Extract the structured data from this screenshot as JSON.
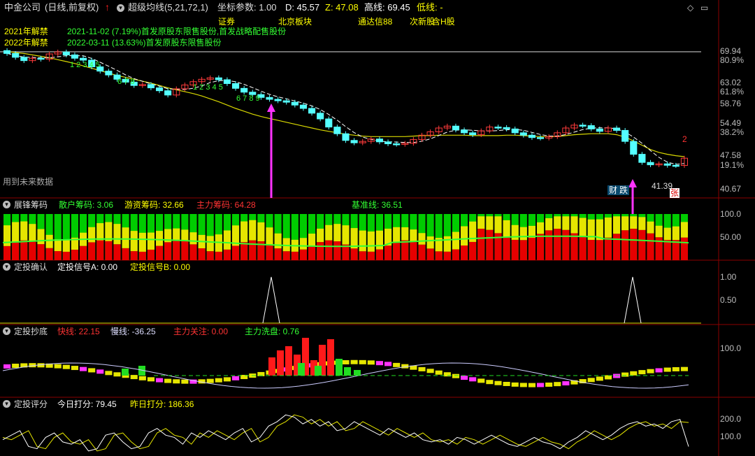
{
  "header": {
    "title": "中金公司",
    "mode": "(日线,前复权)",
    "indicator": "超级均线(5,21,72,1)",
    "coord_label": "坐标参数: 1.00",
    "d_label": "D: 45.57",
    "z_label": "Z: 47.08",
    "high_label": "高线: 69.45",
    "low_label": "低线: -",
    "colors": {
      "title": "#dddddd",
      "d": "#ffffff",
      "z": "#ffff00",
      "high": "#ffffff",
      "low": "#ffff00"
    }
  },
  "main": {
    "notes": [
      {
        "tag": "2021年解禁",
        "text": "2021-11-02 (7.19%)首发原股东限售股份,首发战略配售股份"
      },
      {
        "tag": "2022年解禁",
        "text": "2022-03-11 (13.63%)首发原股东限售股份"
      }
    ],
    "sector_tags": [
      "证券",
      "北京板块",
      "通达信88",
      "次新股",
      "含H股"
    ],
    "future_label": "用到未来数据",
    "price_axis": [
      "69.94",
      "80.9%",
      "63.02",
      "61.8%",
      "58.76",
      "54.49",
      "38.2%",
      "47.58",
      "19.1%",
      "40.67"
    ],
    "markers": {
      "cai": "财",
      "die": "跌",
      "zhang": "张",
      "low_val": "41.39",
      "top_digit": "2"
    },
    "seq_labels": [
      "1 2 3 4 5",
      "6 7 8",
      "1 2 3 4 5",
      "6 7 8 9"
    ]
  },
  "chip": {
    "title": "展锋筹码",
    "items": [
      {
        "label": "散户筹码: 3.06",
        "color": "#ffff00"
      },
      {
        "label": "游资筹码: 32.66",
        "color": "#ffff00"
      },
      {
        "label": "主力筹码: 64.28",
        "color": "#ff3333"
      },
      {
        "label": "基准线: 36.51",
        "color": "#33ff33"
      }
    ],
    "axis": [
      "100.0",
      "50.00"
    ]
  },
  "confirm": {
    "title": "定投确认",
    "items": [
      {
        "label": "定投信号A: 0.00",
        "color": "#ffffff"
      },
      {
        "label": "定投信号B: 0.00",
        "color": "#ffff00"
      }
    ],
    "axis": [
      "1.00",
      "0.50"
    ]
  },
  "bottom": {
    "title": "定投抄底",
    "items": [
      {
        "label": "快线: 22.15",
        "color": "#ff3333"
      },
      {
        "label": "慢线: -36.25",
        "color": "#ddddff"
      },
      {
        "label": "主力关注: 0.00",
        "color": "#ff3333"
      },
      {
        "label": "主力洗盘: 0.76",
        "color": "#33ff33"
      }
    ],
    "axis": [
      "100.0"
    ]
  },
  "score": {
    "title": "定投评分",
    "items": [
      {
        "label": "今日打分: 79.45",
        "color": "#ffffff"
      },
      {
        "label": "昨日打分: 186.36",
        "color": "#ffff00"
      }
    ],
    "axis": [
      "200.0",
      "100.0"
    ]
  },
  "chart_data": [
    {
      "type": "candlestick",
      "title": "中金公司 (日线,前复权)",
      "ylim": [
        40.67,
        69.94
      ],
      "candles_close": [
        69.0,
        68.2,
        67.5,
        68.0,
        67.8,
        68.9,
        69.3,
        68.7,
        68.0,
        67.6,
        66.2,
        65.3,
        64.5,
        63.6,
        63.0,
        62.3,
        62.5,
        61.8,
        61.2,
        60.3,
        61.6,
        62.4,
        63.1,
        63.6,
        63.9,
        63.5,
        62.7,
        61.7,
        60.9,
        60.4,
        59.8,
        59.4,
        59.1,
        58.8,
        58.2,
        57.5,
        56.5,
        55.3,
        53.6,
        52.2,
        50.8,
        50.3,
        50.6,
        51.1,
        50.5,
        50.1,
        50.0,
        50.2,
        51.0,
        51.9,
        52.6,
        53.4,
        53.8,
        53.0,
        52.4,
        52.0,
        52.8,
        53.6,
        53.5,
        53.2,
        52.4,
        51.9,
        51.4,
        51.3,
        51.6,
        52.4,
        53.4,
        54.0,
        53.9,
        53.2,
        52.7,
        53.4,
        52.9,
        50.6,
        47.9,
        46.2,
        45.7,
        45.9,
        45.6,
        45.57,
        47.08
      ],
      "ma_yellow": [
        69.4,
        69.2,
        69.0,
        68.7,
        68.4,
        68.1,
        67.7,
        67.3,
        66.9,
        66.4,
        65.9,
        65.4,
        64.9,
        64.4,
        64.0,
        63.6,
        63.2,
        62.8,
        62.3,
        61.8,
        61.4,
        61.0,
        60.6,
        60.1,
        59.5,
        58.9,
        58.2,
        57.5,
        56.9,
        56.3,
        55.8,
        55.4,
        55.0,
        54.6,
        54.2,
        53.8,
        53.4,
        53.0,
        52.7,
        52.4,
        52.1,
        51.9,
        51.7,
        51.6,
        51.6,
        51.6,
        51.6,
        51.6,
        51.7,
        51.8,
        51.8,
        51.9,
        51.9,
        51.9,
        51.9,
        51.8,
        51.8,
        51.8,
        51.8,
        51.9,
        51.9,
        51.8,
        51.7,
        51.6,
        51.6,
        51.6,
        51.8,
        52.0,
        52.1,
        52.2,
        52.2,
        52.2,
        52.0,
        51.5,
        50.7,
        49.8,
        48.9,
        48.3,
        47.9,
        47.6,
        47.4
      ]
    },
    {
      "type": "bar",
      "title": "展锋筹码",
      "ylim": [
        0,
        100
      ],
      "series": [
        {
          "name": "散户筹码",
          "value": 3.06
        },
        {
          "name": "游资筹码",
          "value": 32.66
        },
        {
          "name": "主力筹码",
          "value": 64.28
        },
        {
          "name": "基准线",
          "value": 36.51
        }
      ]
    },
    {
      "type": "line",
      "title": "定投确认",
      "ylim": [
        0,
        1
      ],
      "series": [
        {
          "name": "定投信号A",
          "values": [
            0.0
          ]
        },
        {
          "name": "定投信号B",
          "values": [
            0.0
          ]
        }
      ],
      "spikes_at_index": [
        38,
        90
      ]
    },
    {
      "type": "bar",
      "title": "定投抄底",
      "series": [
        {
          "name": "快线",
          "value": 22.15
        },
        {
          "name": "慢线",
          "value": -36.25
        },
        {
          "name": "主力关注",
          "value": 0.0
        },
        {
          "name": "主力洗盘",
          "value": 0.76
        }
      ]
    },
    {
      "type": "line",
      "title": "定投评分",
      "ylim": [
        50,
        230
      ],
      "series": [
        {
          "name": "今日打分",
          "values": [
            110,
            130,
            150,
            80,
            70,
            120,
            140,
            100,
            90,
            110,
            60,
            70,
            130,
            140,
            100,
            70,
            80,
            140,
            160,
            130,
            120,
            90,
            140,
            120,
            150,
            130,
            110,
            140,
            160,
            100,
            120,
            170,
            190,
            220,
            210,
            180,
            200,
            170,
            190,
            150,
            160,
            190,
            170,
            150,
            130,
            160,
            140,
            120,
            140,
            110,
            100,
            110,
            90,
            120,
            110,
            90,
            110,
            130,
            110,
            90,
            80,
            100,
            120,
            100,
            90,
            70,
            100,
            120,
            150,
            130,
            110,
            130,
            160,
            180,
            190,
            170,
            180,
            160,
            190,
            200,
            79.45
          ]
        },
        {
          "name": "昨日打分",
          "values": [
            120,
            110,
            130,
            150,
            80,
            70,
            120,
            140,
            100,
            90,
            110,
            60,
            70,
            130,
            140,
            100,
            70,
            80,
            140,
            160,
            130,
            120,
            90,
            140,
            120,
            150,
            130,
            110,
            140,
            160,
            100,
            120,
            170,
            190,
            220,
            210,
            180,
            200,
            170,
            190,
            150,
            160,
            190,
            170,
            150,
            130,
            160,
            140,
            120,
            140,
            110,
            100,
            110,
            90,
            120,
            110,
            90,
            110,
            130,
            110,
            90,
            80,
            100,
            120,
            100,
            90,
            70,
            100,
            120,
            150,
            130,
            110,
            130,
            160,
            180,
            190,
            170,
            180,
            160,
            190,
            186.36
          ]
        }
      ]
    }
  ]
}
